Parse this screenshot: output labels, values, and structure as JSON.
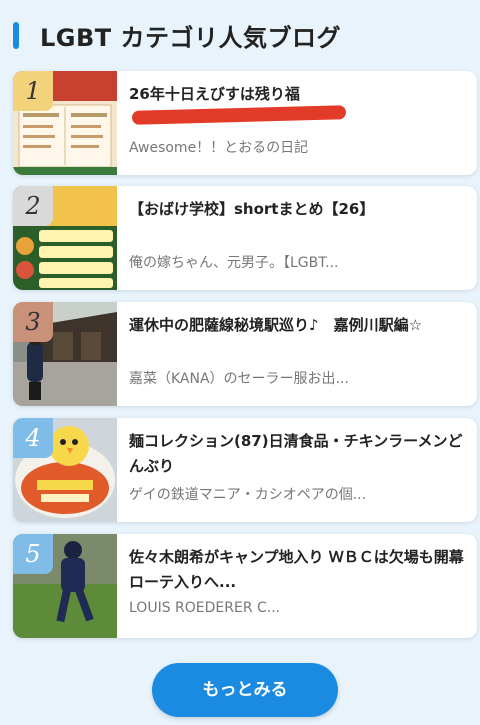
{
  "section": {
    "title": "LGBT カテゴリ人気ブログ"
  },
  "colors": {
    "accent": "#1a8be0",
    "badge_gold": "#f2d27a",
    "badge_gray": "#d9d9d9",
    "badge_bronze": "#c9907a",
    "badge_blue": "#7fbce8"
  },
  "items": [
    {
      "rank": "1",
      "title": "26年十日えびすは残り福",
      "blog": "Awesome！！とおるの日記"
    },
    {
      "rank": "2",
      "title": "【おばけ学校】shortまとめ【26】",
      "blog": "俺の嫁ちゃん、元男子。【LGBT..."
    },
    {
      "rank": "3",
      "title": "運休中の肥薩線秘境駅巡り♪　嘉例川駅編☆",
      "blog": "嘉菜（KANA）のセーラー服お出..."
    },
    {
      "rank": "4",
      "title": "麺コレクション(87)日清食品・チキンラーメンどんぶり",
      "blog": "ゲイの鉄道マニア・カシオペアの個..."
    },
    {
      "rank": "5",
      "title": "佐々木朗希がキャンプ地入り ＷＢＣは欠場も開幕ローテ入りへ...",
      "blog": "LOUIS ROEDERER C..."
    }
  ],
  "more_button": {
    "label": "もっとみる"
  }
}
